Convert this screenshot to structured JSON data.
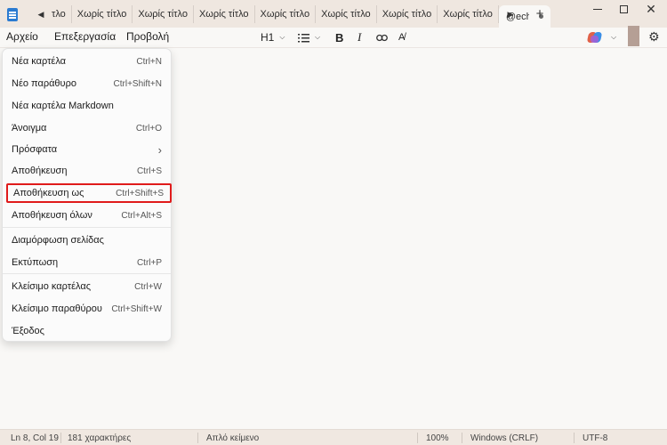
{
  "tabs": {
    "items": [
      {
        "label": "τλο"
      },
      {
        "label": "Χωρίς τίτλο"
      },
      {
        "label": "Χωρίς τίτλο"
      },
      {
        "label": "Χωρίς τίτλο"
      },
      {
        "label": "Χωρίς τίτλο"
      },
      {
        "label": "Χωρίς τίτλο"
      },
      {
        "label": "Χωρίς τίτλο"
      },
      {
        "label": "Χωρίς τίτλο"
      }
    ],
    "active": {
      "label": "@echo"
    },
    "new_tab_icon": "+",
    "scroll_left_icon": "◀",
    "scroll_right_icon": "▶"
  },
  "menubar": {
    "file": "Αρχείο",
    "edit": "Επεξεργασία",
    "view": "Προβολή"
  },
  "toolbar": {
    "heading": "H1",
    "bold": "B",
    "italic": "I"
  },
  "file_menu": {
    "items": [
      {
        "label": "Νέα καρτέλα",
        "shortcut": "Ctrl+N"
      },
      {
        "label": "Νέο παράθυρο",
        "shortcut": "Ctrl+Shift+N"
      },
      {
        "label": "Νέα καρτέλα Markdown",
        "shortcut": ""
      },
      {
        "label": "Άνοιγμα",
        "shortcut": "Ctrl+O"
      },
      {
        "label": "Πρόσφατα",
        "shortcut": "›"
      },
      {
        "label": "Αποθήκευση",
        "shortcut": "Ctrl+S"
      },
      {
        "label": "Αποθήκευση ως",
        "shortcut": "Ctrl+Shift+S"
      },
      {
        "label": "Αποθήκευση όλων",
        "shortcut": "Ctrl+Alt+S"
      },
      {
        "label": "Διαμόρφωση σελίδας",
        "shortcut": ""
      },
      {
        "label": "Εκτύπωση",
        "shortcut": "Ctrl+P"
      },
      {
        "label": "Κλείσιμο καρτέλας",
        "shortcut": "Ctrl+W"
      },
      {
        "label": "Κλείσιμο παραθύρου",
        "shortcut": "Ctrl+Shift+W"
      },
      {
        "label": "Έξοδος",
        "shortcut": ""
      }
    ],
    "highlight_color": "#e01b1b"
  },
  "statusbar": {
    "position": "Ln 8, Col 19",
    "chars": "181 χαρακτήρες",
    "mode": "Απλό κείμενο",
    "zoom": "100%",
    "line_ending": "Windows (CRLF)",
    "encoding": "UTF-8"
  },
  "colors": {
    "titlebar": "#efe7e0",
    "editor": "#f9f8f6",
    "statusbar": "#f0e8e1",
    "app_icon": "#2b7bd1"
  }
}
